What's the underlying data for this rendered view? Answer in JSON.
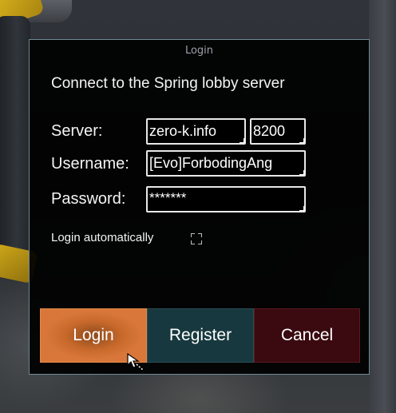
{
  "window": {
    "title": "Login"
  },
  "dialog": {
    "heading": "Connect to the Spring lobby server",
    "server": {
      "label": "Server:",
      "host_value": "zero-k.info",
      "port_value": "8200"
    },
    "username": {
      "label": "Username:",
      "value": "[Evo]ForbodingAng"
    },
    "password": {
      "label": "Password:",
      "value": "*******"
    },
    "auto_login": {
      "label": "Login automatically",
      "checked": false
    }
  },
  "buttons": {
    "login": "Login",
    "register": "Register",
    "cancel": "Cancel"
  },
  "colors": {
    "login_button": "#c8692c",
    "register_button": "#17383e",
    "cancel_button": "#3a0a10",
    "window_border": "#6f8a96"
  },
  "icons": {
    "cursor": "pointer-cursor-icon",
    "checkbox": "checkbox-icon"
  }
}
